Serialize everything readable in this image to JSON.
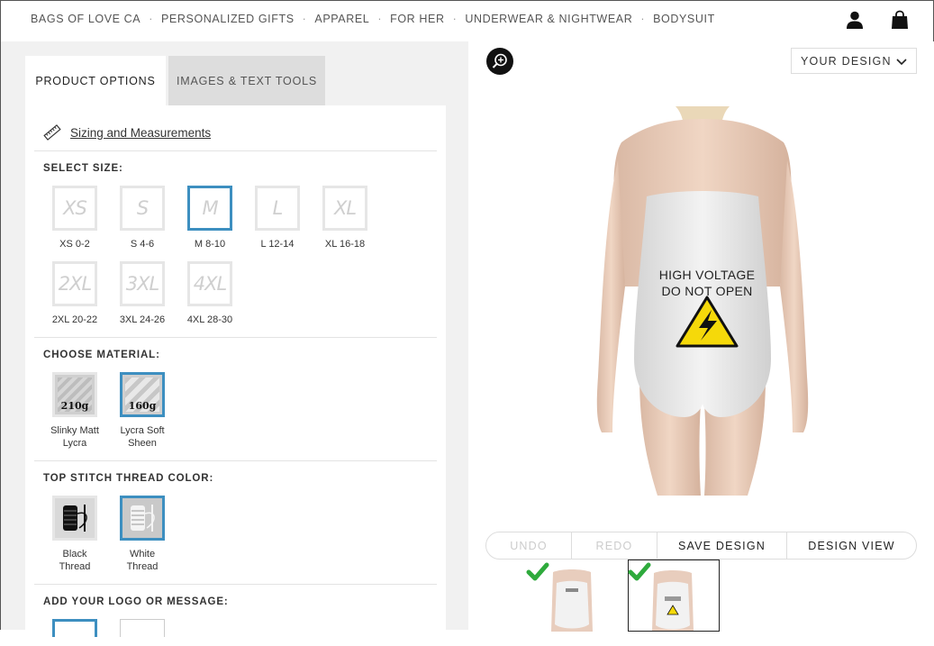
{
  "breadcrumb": {
    "items": [
      "BAGS OF LOVE CA",
      "PERSONALIZED GIFTS",
      "APPAREL",
      "FOR HER",
      "UNDERWEAR & NIGHTWEAR",
      "BODYSUIT"
    ],
    "separator": "·"
  },
  "header_icons": [
    "user-icon",
    "shopping-bag-icon"
  ],
  "tabs": [
    {
      "label": "PRODUCT OPTIONS",
      "active": true
    },
    {
      "label": "IMAGES & TEXT TOOLS",
      "active": false
    }
  ],
  "sizing": {
    "link_text": "Sizing and Measurements",
    "icon": "ruler-icon"
  },
  "size_section": {
    "title": "SELECT SIZE:",
    "sizes": [
      {
        "code": "XS",
        "label": "XS 0-2",
        "selected": false
      },
      {
        "code": "S",
        "label": "S 4-6",
        "selected": false
      },
      {
        "code": "M",
        "label": "M 8-10",
        "selected": true
      },
      {
        "code": "L",
        "label": "L 12-14",
        "selected": false
      },
      {
        "code": "XL",
        "label": "XL 16-18",
        "selected": false
      },
      {
        "code": "2XL",
        "label": "2XL 20-22",
        "selected": false
      },
      {
        "code": "3XL",
        "label": "3XL 24-26",
        "selected": false
      },
      {
        "code": "4XL",
        "label": "4XL 28-30",
        "selected": false
      }
    ]
  },
  "material_section": {
    "title": "CHOOSE MATERIAL:",
    "materials": [
      {
        "weight": "210g",
        "name_line1": "Slinky Matt",
        "name_line2": "Lycra",
        "selected": false
      },
      {
        "weight": "160g",
        "name_line1": "Lycra Soft",
        "name_line2": "Sheen",
        "selected": true
      }
    ]
  },
  "thread_section": {
    "title": "TOP STITCH THREAD COLOR:",
    "threads": [
      {
        "name_line1": "Black",
        "name_line2": "Thread",
        "selected": false
      },
      {
        "name_line1": "White",
        "name_line2": "Thread",
        "selected": true
      }
    ]
  },
  "logo_section": {
    "title": "ADD YOUR LOGO OR MESSAGE:"
  },
  "view_select": {
    "label": "YOUR DESIGN"
  },
  "design": {
    "line1": "HIGH VOLTAGE",
    "line2": "DO NOT OPEN",
    "warning_symbol": "!"
  },
  "actions": {
    "undo": "UNDO",
    "redo": "REDO",
    "save": "SAVE DESIGN",
    "view": "DESIGN VIEW"
  },
  "colors": {
    "accent": "#3d8fc0",
    "check": "#2eaa3c",
    "warning": "#f5d90a"
  }
}
